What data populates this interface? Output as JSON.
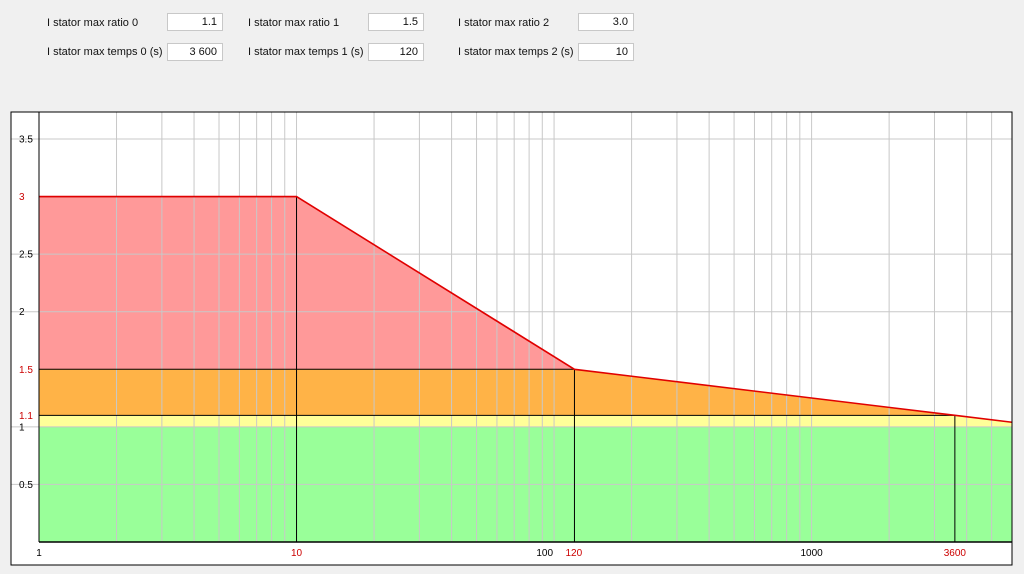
{
  "params": [
    {
      "label": "I stator max ratio 0",
      "value": "1.1"
    },
    {
      "label": "I stator max ratio 1",
      "value": "1.5"
    },
    {
      "label": "I stator max ratio 2",
      "value": "3.0"
    },
    {
      "label": "I stator max temps 0 (s)",
      "value": "3 600"
    },
    {
      "label": "I stator max temps 1 (s)",
      "value": "120"
    },
    {
      "label": "I stator max temps 2 (s)",
      "value": "10"
    }
  ],
  "colors": {
    "danger": "#ff9999",
    "warning": "#ffb347",
    "caution": "#ffff99",
    "safe": "#99ff99",
    "curve": "#e00000",
    "highlight_tick": "#cc0000",
    "grid": "#c8c8c8"
  },
  "chart_data": {
    "type": "area",
    "x_scale": "log",
    "xlim": [
      1,
      6000
    ],
    "ylim": [
      0,
      3.7
    ],
    "grid": true,
    "x_ticks": [
      {
        "value": 1,
        "label": "1",
        "highlight": false
      },
      {
        "value": 10,
        "label": "10",
        "highlight": true
      },
      {
        "value": 100,
        "label": "100",
        "highlight": false
      },
      {
        "value": 120,
        "label": "120",
        "highlight": true
      },
      {
        "value": 1000,
        "label": "1000",
        "highlight": false
      },
      {
        "value": 3600,
        "label": "3600",
        "highlight": true
      }
    ],
    "y_ticks": [
      {
        "value": 0.5,
        "label": "0.5",
        "highlight": false
      },
      {
        "value": 1,
        "label": "1",
        "highlight": false
      },
      {
        "value": 1.1,
        "label": "1.1",
        "highlight": true
      },
      {
        "value": 1.5,
        "label": "1.5",
        "highlight": true
      },
      {
        "value": 2,
        "label": "2",
        "highlight": false
      },
      {
        "value": 2.5,
        "label": "2.5",
        "highlight": false
      },
      {
        "value": 3,
        "label": "3",
        "highlight": true
      },
      {
        "value": 3.5,
        "label": "3.5",
        "highlight": false
      }
    ],
    "curve": [
      {
        "x": 1,
        "y": 3.0
      },
      {
        "x": 10,
        "y": 3.0
      },
      {
        "x": 120,
        "y": 1.5
      },
      {
        "x": 3600,
        "y": 1.1
      },
      {
        "x": 6000,
        "y": 1.04
      }
    ],
    "bands": [
      {
        "name": "safe",
        "y_from": 0,
        "y_to": 1.0
      },
      {
        "name": "caution",
        "y_from": 1.0,
        "y_to": 1.1
      },
      {
        "name": "warning",
        "y_from": 1.1,
        "y_to": 1.5
      },
      {
        "name": "danger",
        "y_from": 1.5,
        "y_to": 3.0
      }
    ]
  }
}
